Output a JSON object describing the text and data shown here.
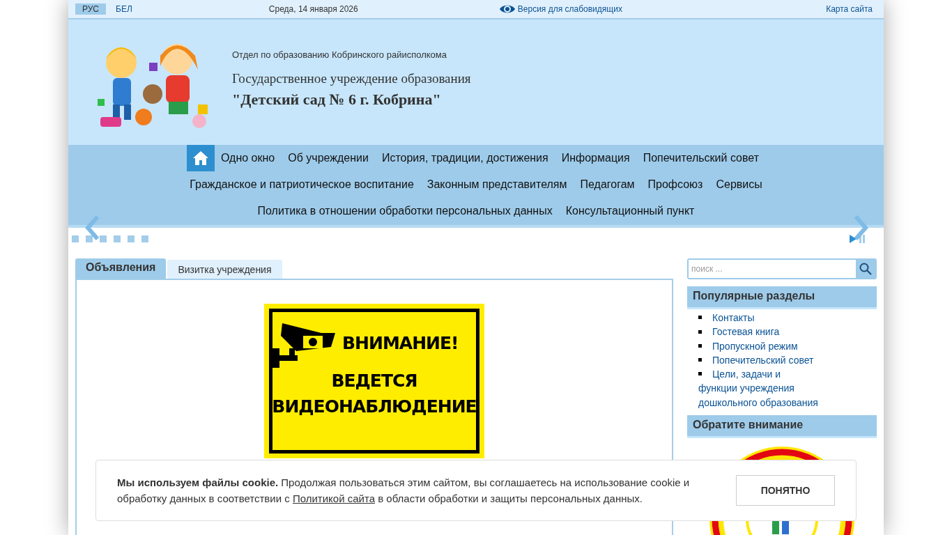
{
  "top_bar": {
    "languages": [
      {
        "label": "РУС",
        "selected": true
      },
      {
        "label": "БЕЛ",
        "selected": false
      }
    ],
    "date": "Среда, 14 января 2026",
    "accessibility_link": "Версия для слабовидящих",
    "sitemap_link": "Карта сайта"
  },
  "header": {
    "subtitle": "Отдел по образованию Кобринского райисполкома",
    "org_type": "Государственное учреждение образования",
    "org_name": "\"Детский сад № 6 г. Кобрина\""
  },
  "nav": {
    "items": [
      "Одно окно",
      "Об учреждении",
      "История, традиции, достижения",
      "Информация",
      "Попечительский совет",
      "Гражданское и патриотическое воспитание",
      "Законным представителям",
      "Педагогам",
      "Профсоюз",
      "Сервисы",
      "Политика в отношении обработки персональных данных",
      "Консультационный пункт"
    ]
  },
  "slider": {
    "dots": [
      {
        "selected": false
      },
      {
        "selected": false
      },
      {
        "selected": false
      },
      {
        "selected": false
      },
      {
        "selected": false
      },
      {
        "selected": false
      }
    ]
  },
  "tabs": [
    {
      "label": "Объявления",
      "selected": true
    },
    {
      "label": "Визитка учреждения",
      "selected": false
    }
  ],
  "notice_sign": {
    "line_1": "ВНИМАНИЕ!",
    "line_2": "ВЕДЕТСЯ",
    "line_3": "ВИДЕОНАБЛЮДЕНИЕ"
  },
  "search": {
    "placeholder": "поиск ..."
  },
  "popular": {
    "title": "Популярные разделы",
    "items": [
      "Контакты",
      "Гостевая книга",
      "Пропускной режим",
      "Попечительский совет",
      "Цели, задачи и функции учреждения дошкольного образования"
    ]
  },
  "attention": {
    "title": "Обратите внимание"
  },
  "cookie": {
    "bold": "Мы используем файлы cookie.",
    "text_before": "Продолжая пользоваться этим сайтом, вы соглашаетесь на использование cookie и обработку данных в соответствии с",
    "link": "Политикой сайта",
    "text_after": "в области обработки и защиты персональных данных.",
    "button": "ПОНЯТНО"
  }
}
